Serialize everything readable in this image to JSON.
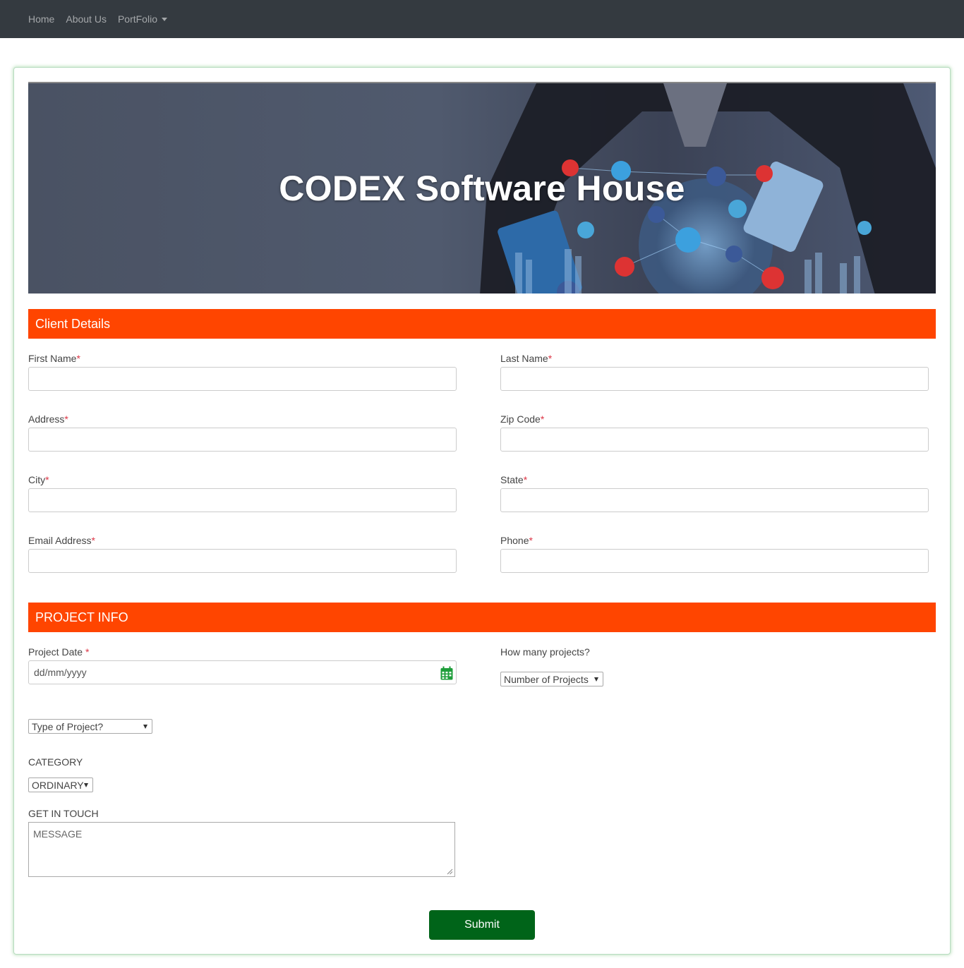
{
  "nav": {
    "items": [
      {
        "label": "Home"
      },
      {
        "label": "About Us"
      },
      {
        "label": "PortFolio"
      }
    ]
  },
  "hero": {
    "title": "CODEX Software House"
  },
  "client_details": {
    "heading": "Client Details",
    "fields": {
      "first_name": "First Name",
      "last_name": "Last Name",
      "address": "Address",
      "zip_code": "Zip Code",
      "city": "City",
      "state": "State",
      "email": "Email Address",
      "phone": "Phone"
    },
    "required_mark": "*"
  },
  "project_info": {
    "heading": "PROJECT INFO",
    "project_date_label": "Project Date ",
    "project_date_placeholder": "dd/mm/yyyy",
    "how_many_label": "How many projects?",
    "number_select": "Number of Projects",
    "type_select": "Type of Project?",
    "category_label": "CATEGORY",
    "category_select": "ORDINARY",
    "get_in_touch_label": "GET IN TOUCH",
    "message_placeholder": "MESSAGE"
  },
  "submit_label": "Submit",
  "colors": {
    "navbar": "#343a40",
    "section_header": "#ff4500",
    "submit": "#006419",
    "required": "#dc3545",
    "calendar_icon": "#1e9e3a"
  }
}
